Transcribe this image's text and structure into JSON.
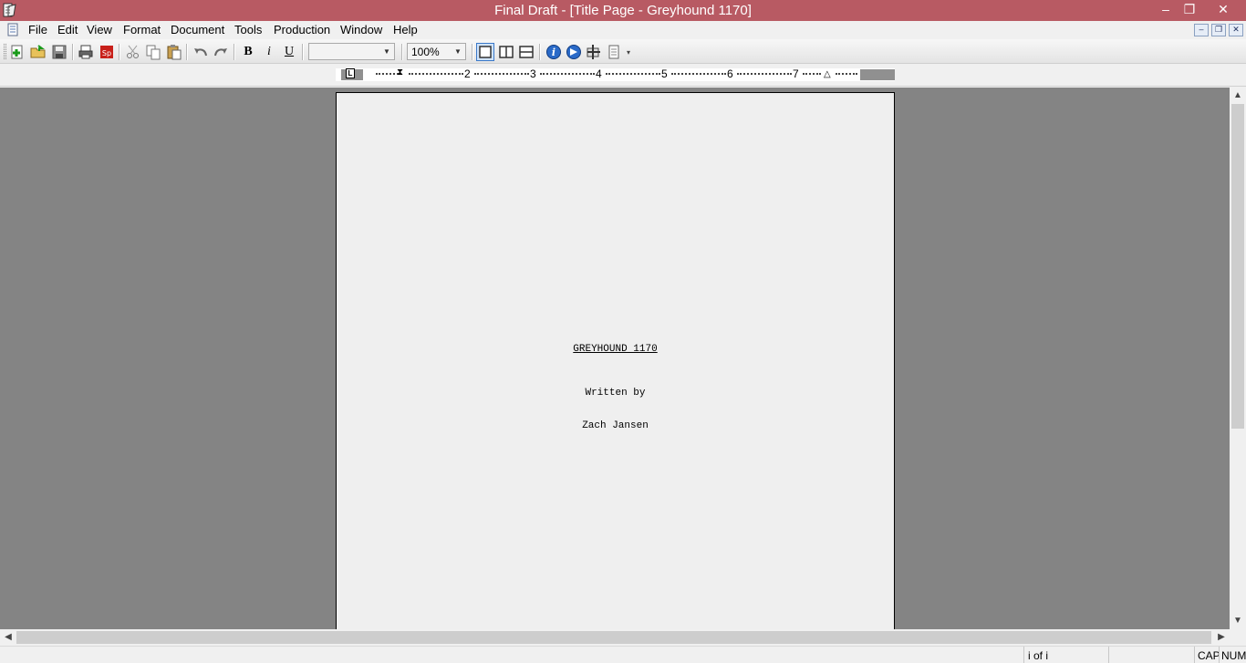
{
  "window": {
    "title": "Final Draft - [Title Page - Greyhound 1170]",
    "titlebar_color": "#b85a63",
    "controls": {
      "minimize": "–",
      "restore": "❐",
      "close": "✕"
    }
  },
  "menu": {
    "items": [
      "File",
      "Edit",
      "View",
      "Format",
      "Document",
      "Tools",
      "Production",
      "Window",
      "Help"
    ],
    "mdi_controls": {
      "minimize": "–",
      "restore": "❐",
      "close": "✕"
    }
  },
  "toolbar": {
    "bold_label": "B",
    "italic_label": "i",
    "underline_label": "U",
    "font_value": "",
    "zoom_value": "100%",
    "icons": [
      "new-document-icon",
      "open-folder-icon",
      "save-icon",
      "print-icon",
      "spell-check-icon",
      "cut-icon",
      "copy-icon",
      "paste-icon",
      "undo-icon",
      "redo-icon",
      "page-view-icon",
      "split-vertical-icon",
      "split-horizontal-icon",
      "info-icon",
      "navigator-icon",
      "scene-view-icon",
      "index-card-icon"
    ]
  },
  "ruler": {
    "tab_marker": "L",
    "numbers": [
      "2",
      "3",
      "4",
      "5",
      "6",
      "7"
    ]
  },
  "page": {
    "title": "GREYHOUND 1170",
    "written_by": "Written by",
    "author": "Zach Jansen"
  },
  "status": {
    "page_count": "i of i",
    "caps": "CAP",
    "num": "NUM"
  }
}
